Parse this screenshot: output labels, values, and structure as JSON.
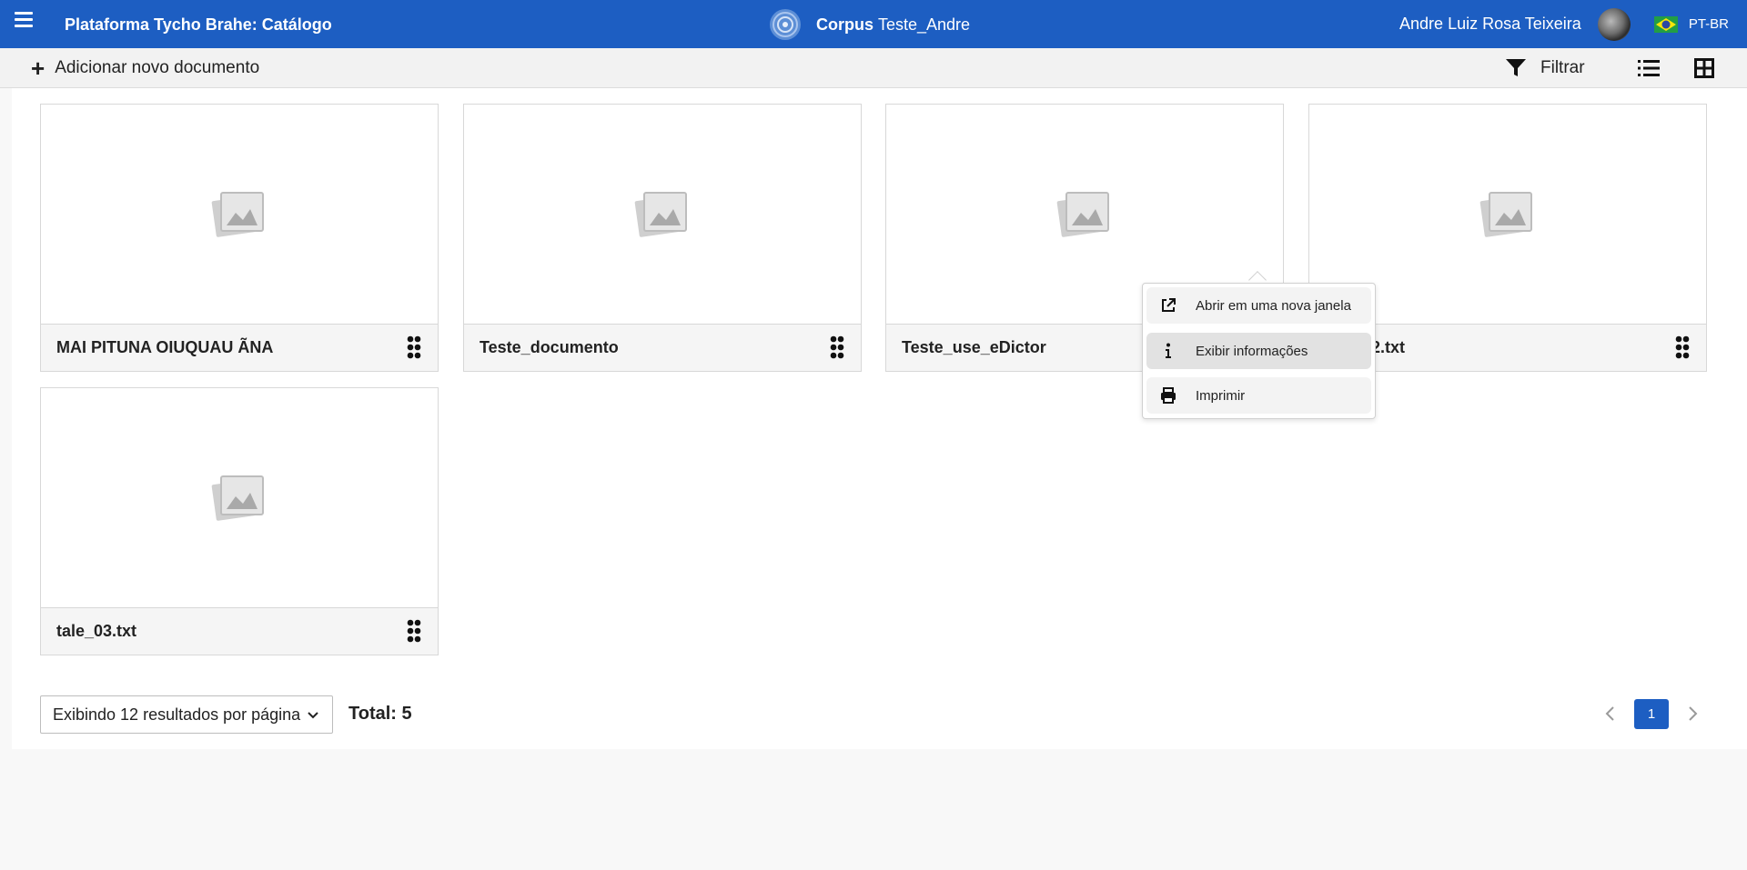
{
  "header": {
    "app_title": "Plataforma Tycho Brahe: Catálogo",
    "corpus_label": "Corpus",
    "corpus_name": "Teste_Andre",
    "user_name": "Andre Luiz Rosa Teixeira",
    "language": "PT-BR",
    "bg_color": "#1d5ec2"
  },
  "toolbar": {
    "add_label": "Adicionar novo documento",
    "filter_label": "Filtrar"
  },
  "documents": [
    {
      "title": "MAI PITUNA OIUQUAU ÃNA"
    },
    {
      "title": "Teste_documento"
    },
    {
      "title": "Teste_use_eDictor"
    },
    {
      "title": "2.txt"
    },
    {
      "title": "tale_03.txt"
    }
  ],
  "context_menu": {
    "items": [
      {
        "label": "Abrir em uma nova janela",
        "icon": "external-link-icon"
      },
      {
        "label": "Exibir informações",
        "icon": "info-icon"
      },
      {
        "label": "Imprimir",
        "icon": "printer-icon"
      }
    ]
  },
  "pagination": {
    "per_page_label": "Exibindo 12 resultados por página",
    "total_label": "Total: 5",
    "current_page": "1"
  }
}
